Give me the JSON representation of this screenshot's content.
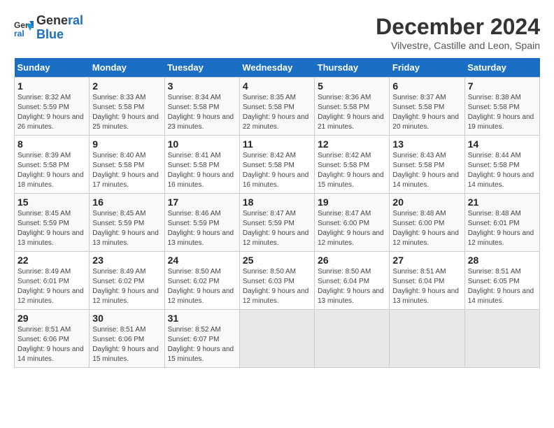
{
  "logo": {
    "line1": "General",
    "line2": "Blue"
  },
  "title": "December 2024",
  "location": "Vilvestre, Castille and Leon, Spain",
  "days_of_week": [
    "Sunday",
    "Monday",
    "Tuesday",
    "Wednesday",
    "Thursday",
    "Friday",
    "Saturday"
  ],
  "weeks": [
    [
      {
        "day": 1,
        "sunrise": "8:32 AM",
        "sunset": "5:59 PM",
        "daylight": "9 hours and 26 minutes."
      },
      {
        "day": 2,
        "sunrise": "8:33 AM",
        "sunset": "5:58 PM",
        "daylight": "9 hours and 25 minutes."
      },
      {
        "day": 3,
        "sunrise": "8:34 AM",
        "sunset": "5:58 PM",
        "daylight": "9 hours and 23 minutes."
      },
      {
        "day": 4,
        "sunrise": "8:35 AM",
        "sunset": "5:58 PM",
        "daylight": "9 hours and 22 minutes."
      },
      {
        "day": 5,
        "sunrise": "8:36 AM",
        "sunset": "5:58 PM",
        "daylight": "9 hours and 21 minutes."
      },
      {
        "day": 6,
        "sunrise": "8:37 AM",
        "sunset": "5:58 PM",
        "daylight": "9 hours and 20 minutes."
      },
      {
        "day": 7,
        "sunrise": "8:38 AM",
        "sunset": "5:58 PM",
        "daylight": "9 hours and 19 minutes."
      }
    ],
    [
      {
        "day": 8,
        "sunrise": "8:39 AM",
        "sunset": "5:58 PM",
        "daylight": "9 hours and 18 minutes."
      },
      {
        "day": 9,
        "sunrise": "8:40 AM",
        "sunset": "5:58 PM",
        "daylight": "9 hours and 17 minutes."
      },
      {
        "day": 10,
        "sunrise": "8:41 AM",
        "sunset": "5:58 PM",
        "daylight": "9 hours and 16 minutes."
      },
      {
        "day": 11,
        "sunrise": "8:42 AM",
        "sunset": "5:58 PM",
        "daylight": "9 hours and 16 minutes."
      },
      {
        "day": 12,
        "sunrise": "8:42 AM",
        "sunset": "5:58 PM",
        "daylight": "9 hours and 15 minutes."
      },
      {
        "day": 13,
        "sunrise": "8:43 AM",
        "sunset": "5:58 PM",
        "daylight": "9 hours and 14 minutes."
      },
      {
        "day": 14,
        "sunrise": "8:44 AM",
        "sunset": "5:58 PM",
        "daylight": "9 hours and 14 minutes."
      }
    ],
    [
      {
        "day": 15,
        "sunrise": "8:45 AM",
        "sunset": "5:59 PM",
        "daylight": "9 hours and 13 minutes."
      },
      {
        "day": 16,
        "sunrise": "8:45 AM",
        "sunset": "5:59 PM",
        "daylight": "9 hours and 13 minutes."
      },
      {
        "day": 17,
        "sunrise": "8:46 AM",
        "sunset": "5:59 PM",
        "daylight": "9 hours and 13 minutes."
      },
      {
        "day": 18,
        "sunrise": "8:47 AM",
        "sunset": "5:59 PM",
        "daylight": "9 hours and 12 minutes."
      },
      {
        "day": 19,
        "sunrise": "8:47 AM",
        "sunset": "6:00 PM",
        "daylight": "9 hours and 12 minutes."
      },
      {
        "day": 20,
        "sunrise": "8:48 AM",
        "sunset": "6:00 PM",
        "daylight": "9 hours and 12 minutes."
      },
      {
        "day": 21,
        "sunrise": "8:48 AM",
        "sunset": "6:01 PM",
        "daylight": "9 hours and 12 minutes."
      }
    ],
    [
      {
        "day": 22,
        "sunrise": "8:49 AM",
        "sunset": "6:01 PM",
        "daylight": "9 hours and 12 minutes."
      },
      {
        "day": 23,
        "sunrise": "8:49 AM",
        "sunset": "6:02 PM",
        "daylight": "9 hours and 12 minutes."
      },
      {
        "day": 24,
        "sunrise": "8:50 AM",
        "sunset": "6:02 PM",
        "daylight": "9 hours and 12 minutes."
      },
      {
        "day": 25,
        "sunrise": "8:50 AM",
        "sunset": "6:03 PM",
        "daylight": "9 hours and 12 minutes."
      },
      {
        "day": 26,
        "sunrise": "8:50 AM",
        "sunset": "6:04 PM",
        "daylight": "9 hours and 13 minutes."
      },
      {
        "day": 27,
        "sunrise": "8:51 AM",
        "sunset": "6:04 PM",
        "daylight": "9 hours and 13 minutes."
      },
      {
        "day": 28,
        "sunrise": "8:51 AM",
        "sunset": "6:05 PM",
        "daylight": "9 hours and 14 minutes."
      }
    ],
    [
      {
        "day": 29,
        "sunrise": "8:51 AM",
        "sunset": "6:06 PM",
        "daylight": "9 hours and 14 minutes."
      },
      {
        "day": 30,
        "sunrise": "8:51 AM",
        "sunset": "6:06 PM",
        "daylight": "9 hours and 15 minutes."
      },
      {
        "day": 31,
        "sunrise": "8:52 AM",
        "sunset": "6:07 PM",
        "daylight": "9 hours and 15 minutes."
      },
      null,
      null,
      null,
      null
    ]
  ],
  "labels": {
    "sunrise": "Sunrise:",
    "sunset": "Sunset:",
    "daylight": "Daylight:"
  }
}
